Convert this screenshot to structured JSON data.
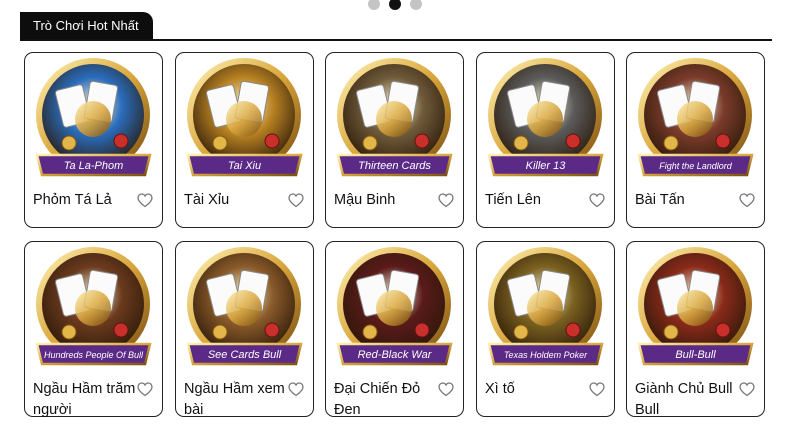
{
  "carousel": {
    "dots": 3,
    "active": 1
  },
  "section": {
    "title": "Trò Chơi Hot Nhất"
  },
  "games": [
    {
      "name": "Phỏm Tá Lả",
      "badge": "Ta La-Phom",
      "art": "cards-phom",
      "bg": "#2a6dbd"
    },
    {
      "name": "Tài Xỉu",
      "badge": "Tai Xiu",
      "art": "dice-cup",
      "bg": "#b88222"
    },
    {
      "name": "Mậu Binh",
      "badge": "Thirteen Cards",
      "art": "revolver-cards",
      "bg": "#6f5b3a"
    },
    {
      "name": "Tiến Lên",
      "badge": "Killer 13",
      "art": "bomb-cards",
      "bg": "#5b5b5b"
    },
    {
      "name": "Bài Tấn",
      "badge": "Fight the Landlord",
      "art": "landlord",
      "bg": "#7b3b2b"
    },
    {
      "name": "Ngầu Hầm trăm người",
      "badge": "Hundreds People Of Bull",
      "art": "cowboy-hat",
      "bg": "#6b3a1e"
    },
    {
      "name": "Ngầu Hầm xem bài",
      "badge": "See Cards Bull",
      "art": "bull-cartoon",
      "bg": "#8a5a2a"
    },
    {
      "name": "Đại Chiến Đỏ Đen",
      "badge": "Red-Black War",
      "art": "vs-cards",
      "bg": "#5a1a1a"
    },
    {
      "name": "Xì tố",
      "badge": "Texas Holdem Poker",
      "art": "crown-cards",
      "bg": "#7a6020"
    },
    {
      "name": "Giành Chủ Bull Bull",
      "badge": "Bull-Bull",
      "art": "gold-bull",
      "bg": "#8a2a1a"
    }
  ],
  "colors": {
    "accent": "#0d0d0d",
    "border": "#222222",
    "ring": "#d9a63c",
    "banner": "#5b2a86"
  }
}
